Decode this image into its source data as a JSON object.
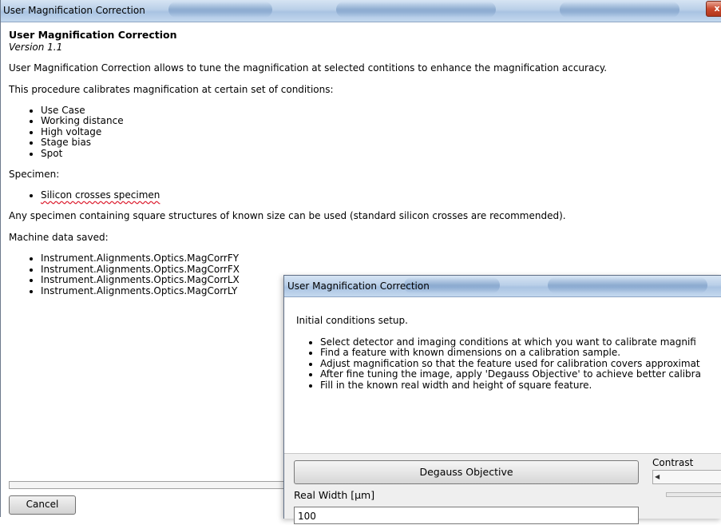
{
  "main_window": {
    "title": "User Magnification Correction",
    "close_label": "x",
    "heading": "User Magnification Correction",
    "version": "Version 1.1",
    "intro": "User Magnification Correction allows to tune the magnification at selected contitions to enhance the magnification accuracy.",
    "procedure_text": "This procedure calibrates magnification at certain set of conditions:",
    "conditions": [
      "Use Case",
      "Working distance",
      "High voltage",
      "Stage bias",
      "Spot"
    ],
    "specimen_label": "Specimen:",
    "specimens": [
      "Silicon crosses specimen"
    ],
    "specimen_note": "Any specimen containing square structures of known size can be used (standard silicon crosses are recommended).",
    "machine_data_label": "Machine data saved:",
    "machine_data": [
      "Instrument.Alignments.Optics.MagCorrFY",
      "Instrument.Alignments.Optics.MagCorrFX",
      "Instrument.Alignments.Optics.MagCorrLX",
      "Instrument.Alignments.Optics.MagCorrLY"
    ],
    "cancel_label": "Cancel"
  },
  "dialog": {
    "title": "User Magnification Correction",
    "intro": "Initial conditions setup.",
    "steps": [
      "Select detector and imaging conditions at which you want to calibrate magnifi",
      "Find a feature with known dimensions on a calibration sample.",
      "Adjust magnification so that the feature used for calibration covers approximat",
      "After fine tuning the image, apply 'Degauss Objective' to achieve better calibra",
      "Fill in the known real width and height of square feature."
    ],
    "degauss_label": "Degauss Objective",
    "contrast_label": "Contrast",
    "real_width_label": "Real Width [µm]",
    "real_width_value": "100"
  }
}
